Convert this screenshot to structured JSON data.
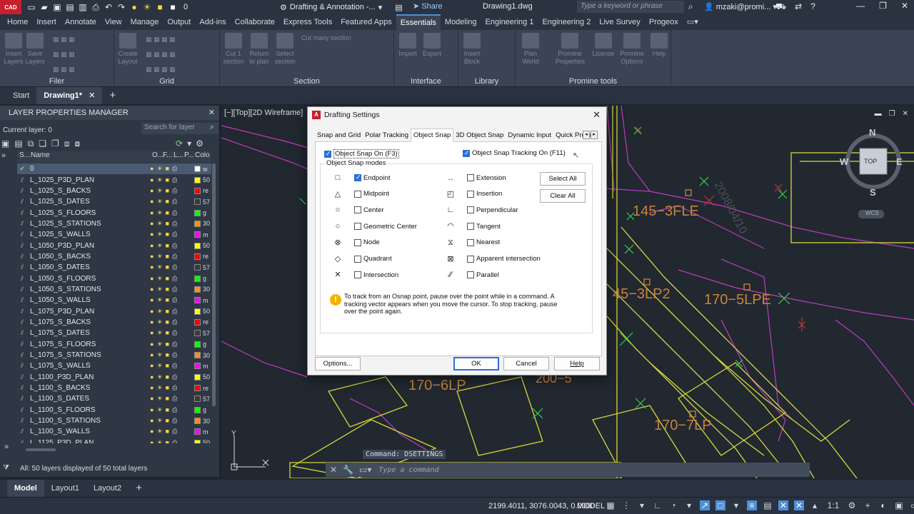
{
  "titlebar": {
    "app_badge": "CAD",
    "layer_value": "0",
    "workspace": "Drafting & Annotation -...",
    "share": "Share",
    "doc_title": "Drawing1.dwg",
    "search_placeholder": "Type a keyword or phrase",
    "user": "mzaki@promi..."
  },
  "ribbon_tabs": [
    "Home",
    "Insert",
    "Annotate",
    "View",
    "Manage",
    "Output",
    "Add-ins",
    "Collaborate",
    "Express Tools",
    "Featured Apps",
    "Essentials",
    "Modeling",
    "Engineering 1",
    "Engineering 2",
    "Live Survey",
    "Progeox"
  ],
  "ribbon_active_tab": "Essentials",
  "ribbon": {
    "filer": {
      "label": "Filer",
      "buttons": [
        "Insert Layers",
        "Save Layers"
      ]
    },
    "grid": {
      "label": "Grid",
      "buttons": [
        "Create Layout"
      ]
    },
    "section": {
      "label": "Section",
      "buttons": [
        "Cut 1 section",
        "Return to plan",
        "Select section"
      ],
      "small": "Cut many section"
    },
    "interface": {
      "label": "Interface",
      "buttons": [
        "Import",
        "Export"
      ]
    },
    "library": {
      "label": "Library",
      "buttons": [
        "Insert Block"
      ]
    },
    "promine": {
      "label": "Promine tools",
      "buttons": [
        "Plan World",
        "Promine Properties",
        "License",
        "Promine Options",
        "Help"
      ]
    }
  },
  "file_tabs": {
    "start": "Start",
    "drawing": "Drawing1*"
  },
  "lpm": {
    "title": "LAYER PROPERTIES MANAGER",
    "current_layer": "Current layer: 0",
    "search_placeholder": "Search for layer",
    "columns": {
      "status": "S...",
      "name": "Name",
      "on": "O...",
      "freeze": "F...",
      "lock": "L...",
      "plot": "P...",
      "color": "Colo"
    },
    "status_text": "All: 50 layers displayed of 50 total layers",
    "rows": [
      {
        "name": "0",
        "color": "#ffffff",
        "cname": "w",
        "current": true
      },
      {
        "name": "L_1025_P3D_PLAN",
        "color": "#ffff00",
        "cname": "50"
      },
      {
        "name": "L_1025_S_BACKS",
        "color": "#ff0000",
        "cname": "re"
      },
      {
        "name": "L_1025_S_DATES",
        "color": "#3a3a3a",
        "cname": "57"
      },
      {
        "name": "L_1025_S_FLOORS",
        "color": "#00ff00",
        "cname": "g"
      },
      {
        "name": "L_1025_S_STATIONS",
        "color": "#ff8c1a",
        "cname": "30"
      },
      {
        "name": "L_1025_S_WALLS",
        "color": "#ff00ff",
        "cname": "m"
      },
      {
        "name": "L_1050_P3D_PLAN",
        "color": "#ffff00",
        "cname": "50"
      },
      {
        "name": "L_1050_S_BACKS",
        "color": "#ff0000",
        "cname": "re"
      },
      {
        "name": "L_1050_S_DATES",
        "color": "#3a3a3a",
        "cname": "57"
      },
      {
        "name": "L_1050_S_FLOORS",
        "color": "#00ff00",
        "cname": "g"
      },
      {
        "name": "L_1050_S_STATIONS",
        "color": "#ff8c1a",
        "cname": "30"
      },
      {
        "name": "L_1050_S_WALLS",
        "color": "#ff00ff",
        "cname": "m"
      },
      {
        "name": "L_1075_P3D_PLAN",
        "color": "#ffff00",
        "cname": "50"
      },
      {
        "name": "L_1075_S_BACKS",
        "color": "#ff0000",
        "cname": "re"
      },
      {
        "name": "L_1075_S_DATES",
        "color": "#3a3a3a",
        "cname": "57"
      },
      {
        "name": "L_1075_S_FLOORS",
        "color": "#00ff00",
        "cname": "g"
      },
      {
        "name": "L_1075_S_STATIONS",
        "color": "#ff8c1a",
        "cname": "30"
      },
      {
        "name": "L_1075_S_WALLS",
        "color": "#ff00ff",
        "cname": "m"
      },
      {
        "name": "L_1100_P3D_PLAN",
        "color": "#ffff00",
        "cname": "50"
      },
      {
        "name": "L_1100_S_BACKS",
        "color": "#ff0000",
        "cname": "re"
      },
      {
        "name": "L_1100_S_DATES",
        "color": "#3a3a3a",
        "cname": "57"
      },
      {
        "name": "L_1100_S_FLOORS",
        "color": "#00ff00",
        "cname": "g"
      },
      {
        "name": "L_1100_S_STATIONS",
        "color": "#ff8c1a",
        "cname": "30"
      },
      {
        "name": "L_1100_S_WALLS",
        "color": "#ff00ff",
        "cname": "m"
      },
      {
        "name": "L_1125_P3D_PLAN",
        "color": "#ffff00",
        "cname": "50"
      }
    ]
  },
  "canvas": {
    "view_label": "[−][Top][2D Wireframe]",
    "labels": [
      "145−3FLE",
      "45−3LP2",
      "170−5LPE",
      "170−6LP",
      "200−5",
      "170−7LP",
      "2008/04/10"
    ],
    "viewcube": {
      "n": "N",
      "s": "S",
      "e": "E",
      "w": "W",
      "top": "TOP",
      "wcs": "WCS"
    },
    "ucs_y": "Y",
    "command_history": "Command: DSETTINGS",
    "command_placeholder": "Type a command"
  },
  "dialog": {
    "title": "Drafting Settings",
    "tabs": [
      "Snap and Grid",
      "Polar Tracking",
      "Object Snap",
      "3D Object Snap",
      "Dynamic Input",
      "Quick Propert"
    ],
    "active_tab": "Object Snap",
    "osnap_on": "Object Snap On (F3)",
    "osnap_tracking": "Object Snap Tracking On (F11)",
    "modes_legend": "Object Snap modes",
    "left_modes": [
      {
        "label": "Endpoint",
        "checked": true,
        "marker": "□"
      },
      {
        "label": "Midpoint",
        "checked": false,
        "marker": "△"
      },
      {
        "label": "Center",
        "checked": false,
        "marker": "○"
      },
      {
        "label": "Geometric Center",
        "checked": false,
        "marker": "○"
      },
      {
        "label": "Node",
        "checked": false,
        "marker": "⊗"
      },
      {
        "label": "Quadrant",
        "checked": false,
        "marker": "◇"
      },
      {
        "label": "Intersection",
        "checked": false,
        "marker": "✕"
      }
    ],
    "right_modes": [
      {
        "label": "Extension",
        "checked": false,
        "marker": "․․"
      },
      {
        "label": "Insertion",
        "checked": false,
        "marker": "◰"
      },
      {
        "label": "Perpendicular",
        "checked": false,
        "marker": "∟"
      },
      {
        "label": "Tangent",
        "checked": false,
        "marker": "◠"
      },
      {
        "label": "Nearest",
        "checked": false,
        "marker": "⧖"
      },
      {
        "label": "Apparent intersection",
        "checked": false,
        "marker": "⊠"
      },
      {
        "label": "Parallel",
        "checked": false,
        "marker": "∕∕"
      }
    ],
    "select_all": "Select All",
    "clear_all": "Clear All",
    "info": "To track from an Osnap point, pause over the point while in a command.  A tracking vector appears when you move the cursor.  To stop tracking, pause over the point again.",
    "options": "Options...",
    "ok": "OK",
    "cancel": "Cancel",
    "help": "Help"
  },
  "layout_tabs": [
    "Model",
    "Layout1",
    "Layout2"
  ],
  "statusbar": {
    "coords": "2199.4011, 3076.0043, 0.0000",
    "model": "MODEL",
    "scale": "1:1"
  }
}
